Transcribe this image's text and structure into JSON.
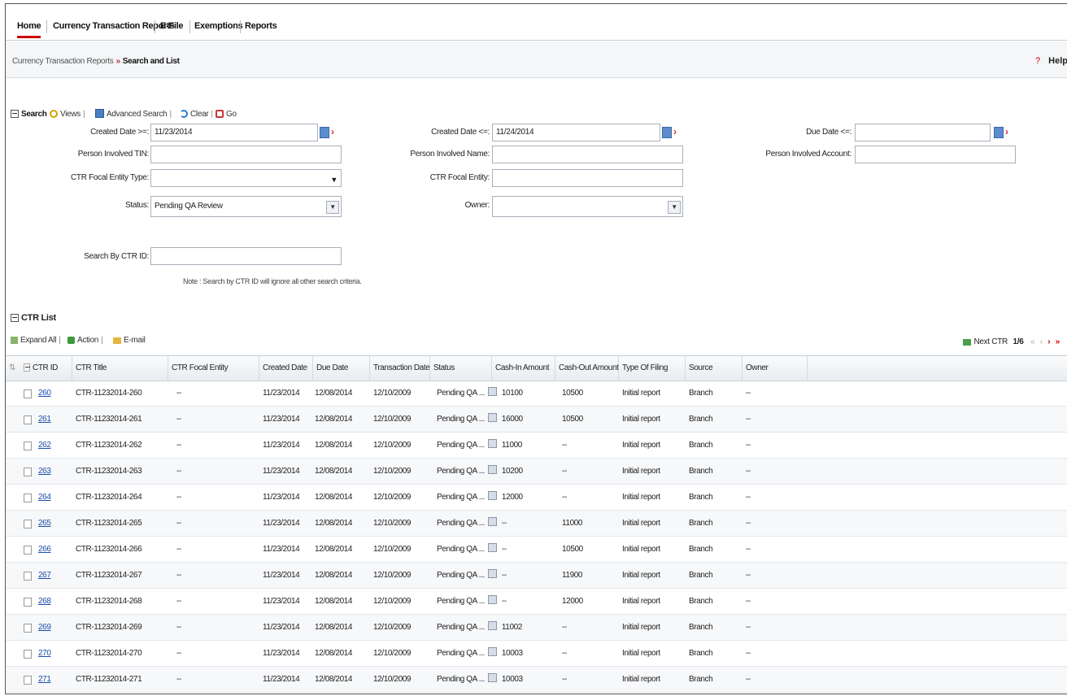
{
  "nav": {
    "tabs": [
      "Home",
      "Currency Transaction Reports",
      "E-File",
      "Exemptions",
      "Reports"
    ],
    "active": "Home"
  },
  "breadcrumb": {
    "parent": "Currency Transaction Reports",
    "current": "Search and List"
  },
  "help": "Help",
  "toolbar": {
    "search": "Search",
    "views": "Views",
    "advanced": "Advanced Search",
    "clear": "Clear",
    "go": "Go"
  },
  "form": {
    "created_from_label": "Created Date >=:",
    "created_from_value": "11/23/2014",
    "created_to_label": "Created Date <=:",
    "created_to_value": "11/24/2014",
    "due_date_label": "Due Date <=:",
    "due_date_value": "",
    "person_tin_label": "Person Involved TIN:",
    "person_name_label": "Person Involved Name:",
    "person_account_label": "Person Involved Account:",
    "focal_type_label": "CTR Focal Entity Type:",
    "focal_entity_label": "CTR Focal Entity:",
    "status_label": "Status:",
    "status_value": "Pending QA Review",
    "owner_label": "Owner:",
    "owner_value": "",
    "ctr_id_label": "Search By CTR ID:",
    "note": "Note : Search by CTR ID will ignore all other search criteria."
  },
  "list": {
    "title": "CTR List",
    "expand_all": "Expand All",
    "action": "Action",
    "email": "E-mail",
    "next_ctr": "Next CTR",
    "page": "1/6"
  },
  "table": {
    "columns": [
      "CTR ID",
      "CTR Title",
      "CTR Focal Entity",
      "Created Date",
      "Due Date",
      "Transaction Date",
      "Status",
      "Cash-In Amount",
      "Cash-Out Amount",
      "Type Of Filing",
      "Source",
      "Owner"
    ],
    "rows": [
      {
        "id": "260",
        "title": "CTR-11232014-260",
        "focal": "--",
        "created": "11/23/2014",
        "due": "12/08/2014",
        "txn": "12/10/2009",
        "status": "Pending QA ...",
        "cash_in": "10100",
        "cash_out": "10500",
        "filing": "Initial report",
        "source": "Branch",
        "owner": "--"
      },
      {
        "id": "261",
        "title": "CTR-11232014-261",
        "focal": "--",
        "created": "11/23/2014",
        "due": "12/08/2014",
        "txn": "12/10/2009",
        "status": "Pending QA ...",
        "cash_in": "16000",
        "cash_out": "10500",
        "filing": "Initial report",
        "source": "Branch",
        "owner": "--"
      },
      {
        "id": "262",
        "title": "CTR-11232014-262",
        "focal": "--",
        "created": "11/23/2014",
        "due": "12/08/2014",
        "txn": "12/10/2009",
        "status": "Pending QA ...",
        "cash_in": "11000",
        "cash_out": "--",
        "filing": "Initial report",
        "source": "Branch",
        "owner": "--"
      },
      {
        "id": "263",
        "title": "CTR-11232014-263",
        "focal": "--",
        "created": "11/23/2014",
        "due": "12/08/2014",
        "txn": "12/10/2009",
        "status": "Pending QA ...",
        "cash_in": "10200",
        "cash_out": "--",
        "filing": "Initial report",
        "source": "Branch",
        "owner": "--"
      },
      {
        "id": "264",
        "title": "CTR-11232014-264",
        "focal": "--",
        "created": "11/23/2014",
        "due": "12/08/2014",
        "txn": "12/10/2009",
        "status": "Pending QA ...",
        "cash_in": "12000",
        "cash_out": "--",
        "filing": "Initial report",
        "source": "Branch",
        "owner": "--"
      },
      {
        "id": "265",
        "title": "CTR-11232014-265",
        "focal": "--",
        "created": "11/23/2014",
        "due": "12/08/2014",
        "txn": "12/10/2009",
        "status": "Pending QA ...",
        "cash_in": "--",
        "cash_out": "11000",
        "filing": "Initial report",
        "source": "Branch",
        "owner": "--"
      },
      {
        "id": "266",
        "title": "CTR-11232014-266",
        "focal": "--",
        "created": "11/23/2014",
        "due": "12/08/2014",
        "txn": "12/10/2009",
        "status": "Pending QA ...",
        "cash_in": "--",
        "cash_out": "10500",
        "filing": "Initial report",
        "source": "Branch",
        "owner": "--"
      },
      {
        "id": "267",
        "title": "CTR-11232014-267",
        "focal": "--",
        "created": "11/23/2014",
        "due": "12/08/2014",
        "txn": "12/10/2009",
        "status": "Pending QA ...",
        "cash_in": "--",
        "cash_out": "11900",
        "filing": "Initial report",
        "source": "Branch",
        "owner": "--"
      },
      {
        "id": "268",
        "title": "CTR-11232014-268",
        "focal": "--",
        "created": "11/23/2014",
        "due": "12/08/2014",
        "txn": "12/10/2009",
        "status": "Pending QA ...",
        "cash_in": "--",
        "cash_out": "12000",
        "filing": "Initial report",
        "source": "Branch",
        "owner": "--"
      },
      {
        "id": "269",
        "title": "CTR-11232014-269",
        "focal": "--",
        "created": "11/23/2014",
        "due": "12/08/2014",
        "txn": "12/10/2009",
        "status": "Pending QA ...",
        "cash_in": "11002",
        "cash_out": "--",
        "filing": "Initial report",
        "source": "Branch",
        "owner": "--"
      },
      {
        "id": "270",
        "title": "CTR-11232014-270",
        "focal": "--",
        "created": "11/23/2014",
        "due": "12/08/2014",
        "txn": "12/10/2009",
        "status": "Pending QA ...",
        "cash_in": "10003",
        "cash_out": "--",
        "filing": "Initial report",
        "source": "Branch",
        "owner": "--"
      },
      {
        "id": "271",
        "title": "CTR-11232014-271",
        "focal": "--",
        "created": "11/23/2014",
        "due": "12/08/2014",
        "txn": "12/10/2009",
        "status": "Pending QA ...",
        "cash_in": "10003",
        "cash_out": "--",
        "filing": "Initial report",
        "source": "Branch",
        "owner": "--"
      }
    ]
  }
}
